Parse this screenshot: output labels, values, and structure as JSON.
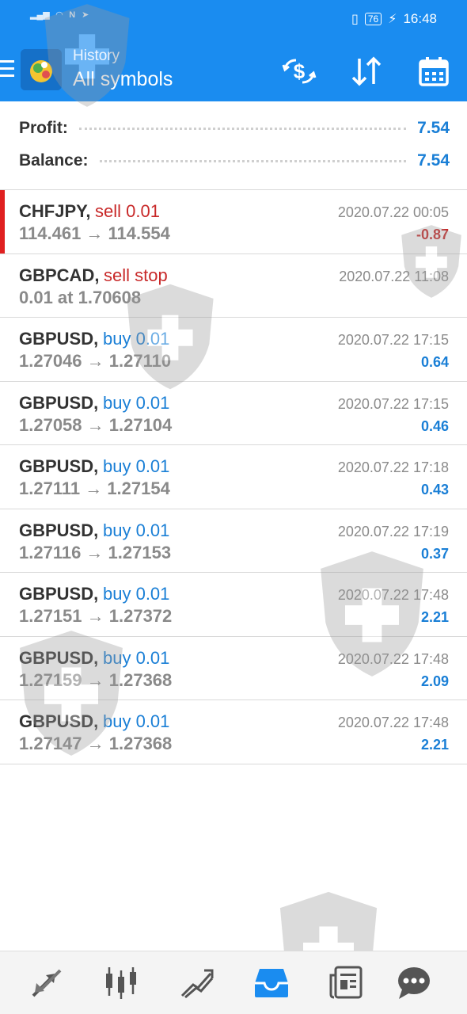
{
  "status_bar": {
    "battery": "76",
    "time": "16:48"
  },
  "header": {
    "title_small": "History",
    "title_big": "All symbols"
  },
  "summary": {
    "profit_label": "Profit:",
    "profit_value": "7.54",
    "balance_label": "Balance:",
    "balance_value": "7.54"
  },
  "trades": [
    {
      "symbol": "CHFJPY,",
      "op": "sell 0.01",
      "op_type": "sell",
      "prices": "114.461 → 114.554",
      "datetime": "2020.07.22 00:05",
      "pl": "-0.87",
      "pl_sign": "neg"
    },
    {
      "symbol": "GBPCAD,",
      "op": "sell stop",
      "op_type": "sell",
      "prices": "0.01 at 1.70608",
      "datetime": "2020.07.22 11:08",
      "pl": "",
      "pl_sign": "pos"
    },
    {
      "symbol": "GBPUSD,",
      "op": "buy 0.01",
      "op_type": "buy",
      "prices": "1.27046 → 1.27110",
      "datetime": "2020.07.22 17:15",
      "pl": "0.64",
      "pl_sign": "pos"
    },
    {
      "symbol": "GBPUSD,",
      "op": "buy 0.01",
      "op_type": "buy",
      "prices": "1.27058 → 1.27104",
      "datetime": "2020.07.22 17:15",
      "pl": "0.46",
      "pl_sign": "pos"
    },
    {
      "symbol": "GBPUSD,",
      "op": "buy 0.01",
      "op_type": "buy",
      "prices": "1.27111 → 1.27154",
      "datetime": "2020.07.22 17:18",
      "pl": "0.43",
      "pl_sign": "pos"
    },
    {
      "symbol": "GBPUSD,",
      "op": "buy 0.01",
      "op_type": "buy",
      "prices": "1.27116 → 1.27153",
      "datetime": "2020.07.22 17:19",
      "pl": "0.37",
      "pl_sign": "pos"
    },
    {
      "symbol": "GBPUSD,",
      "op": "buy 0.01",
      "op_type": "buy",
      "prices": "1.27151 → 1.27372",
      "datetime": "2020.07.22 17:48",
      "pl": "2.21",
      "pl_sign": "pos"
    },
    {
      "symbol": "GBPUSD,",
      "op": "buy 0.01",
      "op_type": "buy",
      "prices": "1.27159 → 1.27368",
      "datetime": "2020.07.22 17:48",
      "pl": "2.09",
      "pl_sign": "pos"
    },
    {
      "symbol": "GBPUSD,",
      "op": "buy 0.01",
      "op_type": "buy",
      "prices": "1.27147 → 1.27368",
      "datetime": "2020.07.22 17:48",
      "pl": "2.21",
      "pl_sign": "pos"
    }
  ],
  "colors": {
    "header_bg": "#1a8cf0",
    "accent_blue": "#1a7fd6",
    "sell_red": "#c82828",
    "active_marker": "#e02020",
    "nav_active": "#1a8cf0",
    "nav_inactive": "#555555"
  },
  "icons": {
    "toolbar": [
      "currency-exchange-icon",
      "sort-icon",
      "calendar-icon"
    ],
    "bottom_nav": [
      "quotes-icon",
      "chart-icon",
      "trade-icon",
      "history-icon",
      "news-icon",
      "chat-icon"
    ],
    "active_nav": "history-icon"
  }
}
